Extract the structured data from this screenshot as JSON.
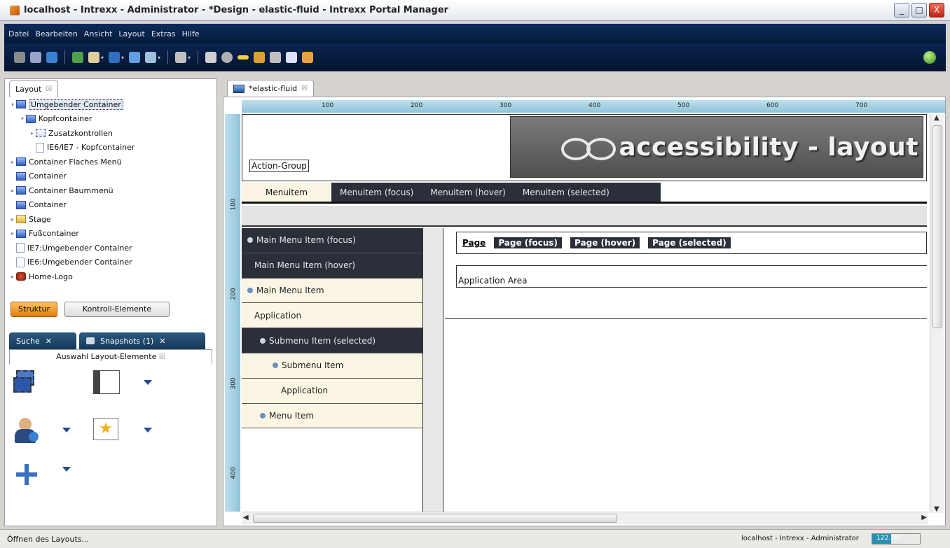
{
  "window": {
    "title": "localhost - Intrexx - Administrator - *Design - elastic-fluid - Intrexx Portal Manager",
    "controls": [
      "_",
      "□",
      "X"
    ]
  },
  "menubar": [
    "Datei",
    "Bearbeiten",
    "Ansicht",
    "Layout",
    "Extras",
    "Hilfe"
  ],
  "toolbar": {
    "icons": [
      "database-icon",
      "db-user-icon",
      "globe-icon",
      "monitor-icon",
      "open-icon",
      "save-icon",
      "deploy-icon",
      "export-icon",
      "box-icon",
      "box2-icon",
      "circle-icon",
      "minus-icon",
      "palette-icon",
      "cloud-icon",
      "page-edit-icon",
      "rocket-icon"
    ],
    "colors": [
      "#8a8a8a",
      "#9aa4c8",
      "#3a80d0",
      "#50a050",
      "#e0d0a0",
      "#3070c0",
      "#60a0e0",
      "#a0c0e0",
      "#c0c0c0",
      "#d0d0d0",
      "#b0b0b0",
      "#f0d040",
      "#e0a030",
      "#c0c0c0",
      "#e0e0ff",
      "#f0a040"
    ]
  },
  "left_panel": {
    "tab": "Layout",
    "tree": [
      {
        "label": "Umgebender Container",
        "depth": 0,
        "twisty": "▾",
        "icon": "container-icon",
        "selected": true
      },
      {
        "label": "Kopfcontainer",
        "depth": 1,
        "twisty": "▾",
        "icon": "container-icon"
      },
      {
        "label": "Zusatzkontrollen",
        "depth": 2,
        "twisty": "▸",
        "icon": "toolbox-icon"
      },
      {
        "label": "IE6/IE7 - Kopfcontainer",
        "depth": 2,
        "twisty": "",
        "icon": "page-icon"
      },
      {
        "label": "Container Flaches Menü",
        "depth": 0,
        "twisty": "▸",
        "icon": "container-icon"
      },
      {
        "label": "Container",
        "depth": 0,
        "twisty": "",
        "icon": "container-icon"
      },
      {
        "label": "Container Baummenü",
        "depth": 0,
        "twisty": "▸",
        "icon": "container-icon"
      },
      {
        "label": "Container",
        "depth": 0,
        "twisty": "",
        "icon": "container-icon"
      },
      {
        "label": "Stage",
        "depth": 0,
        "twisty": "▸",
        "icon": "stage-icon"
      },
      {
        "label": "Fußcontainer",
        "depth": 0,
        "twisty": "▸",
        "icon": "container-icon"
      },
      {
        "label": "IE7:Umgebender Container",
        "depth": 0,
        "twisty": "",
        "icon": "page-icon"
      },
      {
        "label": "IE6:Umgebender Container",
        "depth": 0,
        "twisty": "",
        "icon": "page-icon"
      },
      {
        "label": "Home-Logo",
        "depth": 0,
        "twisty": "▸",
        "icon": "logo-icon"
      }
    ],
    "buttons": {
      "struktur": "Struktur",
      "kontroll": "Kontroll-Elemente"
    },
    "bottom_tabs": {
      "suche": "Suche",
      "snapshots": "Snapshots (1)",
      "close": "✕"
    },
    "bottom_subtab": "Auswahl Layout-Elemente",
    "tab_close": "☒"
  },
  "editor": {
    "tab": "*elastic-fluid",
    "ruler_top": [
      "100",
      "200",
      "300",
      "400",
      "500",
      "600",
      "700"
    ],
    "ruler_left": [
      "100",
      "200",
      "300",
      "400"
    ],
    "action_group": "Action-Group",
    "banner": "accessibility - layout",
    "top_menu": [
      "Menuitem",
      "Menuitem (focus)",
      "Menuitem (hover)",
      "Menuitem (selected)"
    ],
    "side_menu": [
      {
        "label": "Main Menu Item (focus)",
        "style": "dark",
        "bullet": true,
        "indent": 8
      },
      {
        "label": "Main Menu Item (hover)",
        "style": "dark",
        "bullet": false,
        "indent": 18
      },
      {
        "label": "Main Menu Item",
        "style": "light",
        "bullet": true,
        "indent": 8
      },
      {
        "label": "Application",
        "style": "light",
        "bullet": false,
        "indent": 18
      },
      {
        "label": "Submenu Item (selected)",
        "style": "dark",
        "bullet": true,
        "indent": 26
      },
      {
        "label": "Submenu Item",
        "style": "light",
        "bullet": true,
        "indent": 44
      },
      {
        "label": "Application",
        "style": "light",
        "bullet": false,
        "indent": 56
      },
      {
        "label": "Menu Item",
        "style": "light",
        "bullet": true,
        "indent": 26
      }
    ],
    "page_tabs": [
      "Page",
      "Page (focus)",
      "Page (hover)",
      "Page (selected)"
    ],
    "app_area": "Application Area"
  },
  "statusbar": {
    "left": "Öffnen des Layouts...",
    "right": "localhost - Intrexx - Administrator",
    "memory": "122.7M",
    "memory_fill": 0.4
  }
}
